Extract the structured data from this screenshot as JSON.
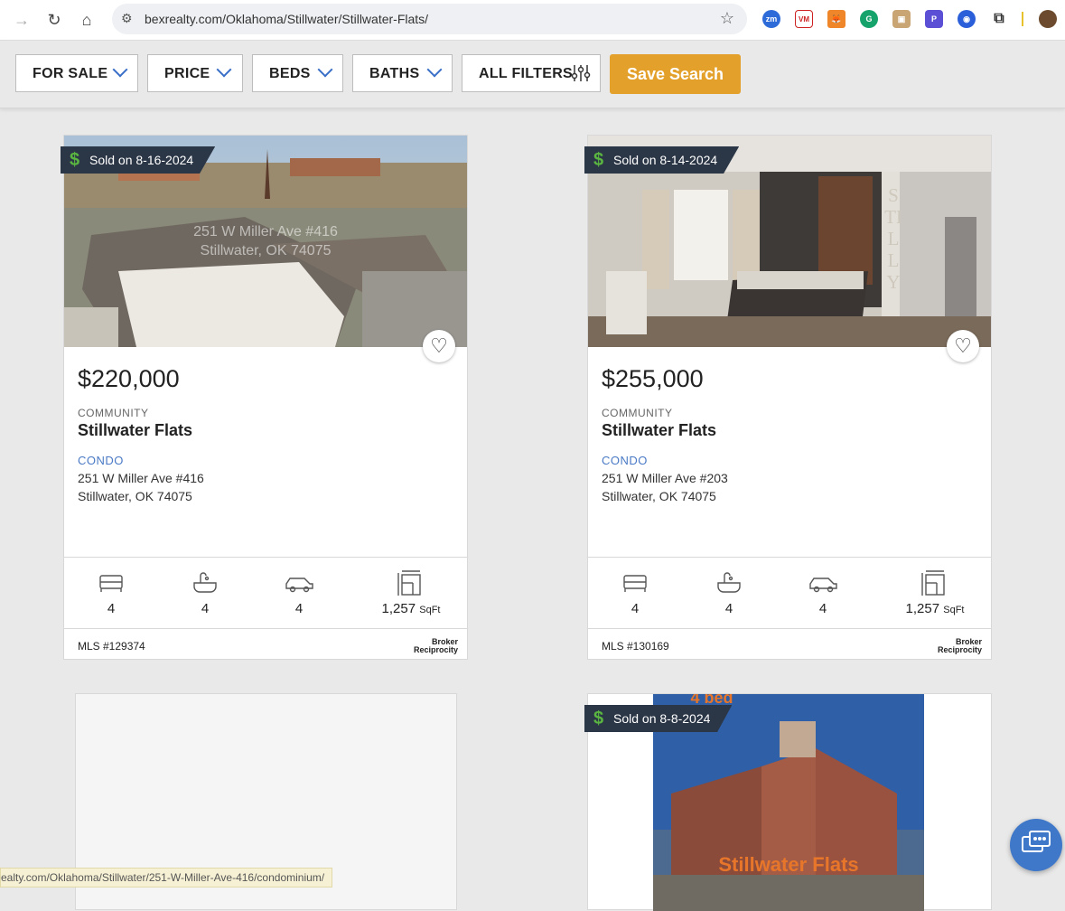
{
  "browser": {
    "url": "bexrealty.com/Oklahoma/Stillwater/Stillwater-Flats/",
    "extensions": [
      "zoom",
      "vm",
      "metamask",
      "grammarly",
      "ext-box",
      "ext-purple",
      "ext-circle",
      "puzzle-icon"
    ]
  },
  "filters": {
    "for_sale": "FOR SALE",
    "price": "PRICE",
    "beds": "BEDS",
    "baths": "BATHS",
    "all_filters": "ALL FILTERS",
    "save_search": "Save Search"
  },
  "listings": [
    {
      "sold": "Sold on 8-16-2024",
      "watermark_line1": "251 W Miller Ave #416",
      "watermark_line2": "Stillwater, OK 74075",
      "price": "$220,000",
      "community_label": "COMMUNITY",
      "community": "Stillwater Flats",
      "type": "CONDO",
      "address1": "251 W Miller Ave #416",
      "address2": "Stillwater, OK 74075",
      "beds": "4",
      "baths": "4",
      "garage": "4",
      "sqft": "1,257",
      "sqft_unit": "SqFt",
      "mls": "MLS #129374",
      "broker_line1": "Broker",
      "broker_line2": "Reciprocity"
    },
    {
      "sold": "Sold on 8-14-2024",
      "price": "$255,000",
      "community_label": "COMMUNITY",
      "community": "Stillwater Flats",
      "type": "CONDO",
      "address1": "251 W Miller Ave #203",
      "address2": "Stillwater, OK 74075",
      "beds": "4",
      "baths": "4",
      "garage": "4",
      "sqft": "1,257",
      "sqft_unit": "SqFt",
      "mls": "MLS #130169",
      "broker_line1": "Broker",
      "broker_line2": "Reciprocity",
      "wall_text": "STILLY"
    },
    {
      "placeholder": true
    },
    {
      "sold": "Sold on 8-8-2024",
      "photo_top_text": "4 bed",
      "photo_bottom_text": "Stillwater Flats"
    }
  ],
  "statusbar": "ealty.com/Oklahoma/Stillwater/251-W-Miller-Ave-416/condominium/"
}
